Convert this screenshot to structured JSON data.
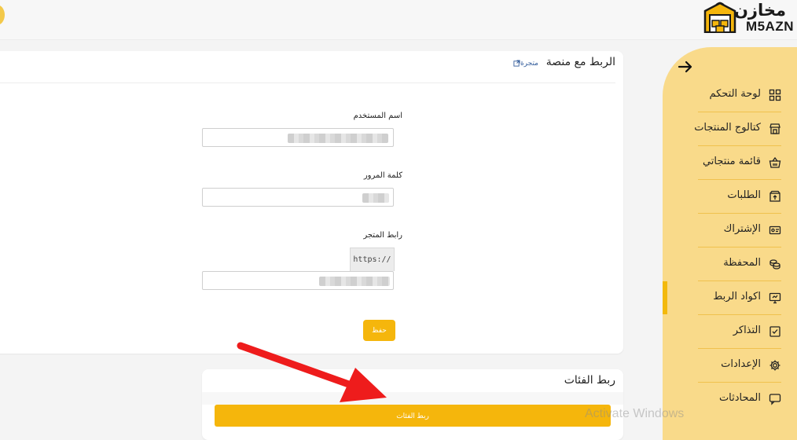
{
  "logo": {
    "arabic": "مخازن",
    "english": "M5AZN"
  },
  "colors": {
    "accent": "#f5b60c",
    "sidebar": "#f9da8a",
    "arrow": "#ee1c1c"
  },
  "sidebar": {
    "back_icon": "arrow-right-icon",
    "items": [
      {
        "label": "لوحة التحكم",
        "icon": "dashboard-grid-icon"
      },
      {
        "label": "كتالوج المنتجات",
        "icon": "store-icon"
      },
      {
        "label": "قائمة منتجاتي",
        "icon": "basket-icon"
      },
      {
        "label": "الطلبات",
        "icon": "box-arrow-up-icon"
      },
      {
        "label": "الإشتراك",
        "icon": "id-card-icon"
      },
      {
        "label": "المحفظة",
        "icon": "coins-icon"
      },
      {
        "label": "اكواد الربط",
        "icon": "monitor-icon"
      },
      {
        "label": "التذاكر",
        "icon": "ticket-check-icon"
      },
      {
        "label": "الإعدادات",
        "icon": "gear-icon"
      },
      {
        "label": "المحادثات",
        "icon": "chat-icon"
      }
    ],
    "active_index": 6
  },
  "connect": {
    "title": "الربط مع منصة",
    "store_tag": "متجرة",
    "username_label": "اسم المستخدم",
    "password_label": "كلمة المرور",
    "store_url_label": "رابط المتجر",
    "url_prefix": "https://",
    "save_label": "حفظ"
  },
  "categories": {
    "title": "ربط الفئات",
    "button_label": "ربط الفئات"
  },
  "watermark": "Activate Windows"
}
